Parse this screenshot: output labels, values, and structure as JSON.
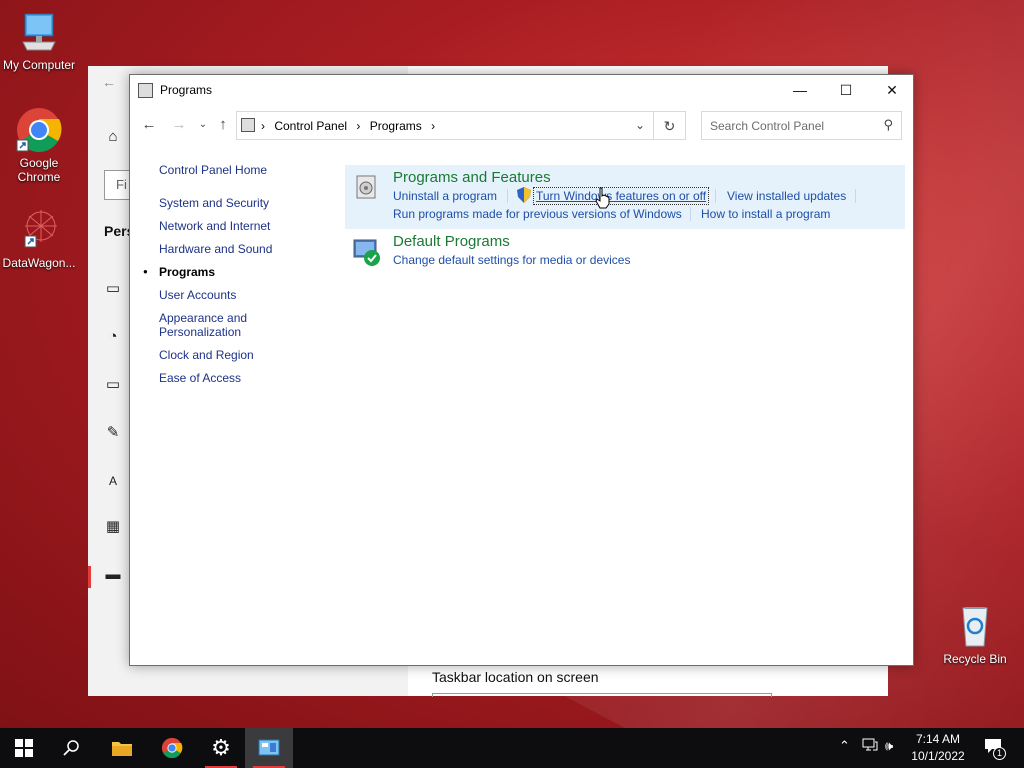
{
  "desktop": {
    "icons": [
      {
        "label": "My Computer",
        "icon": "computer-icon"
      },
      {
        "label": "Google Chrome",
        "icon": "chrome-icon"
      },
      {
        "label": "DataWagon...",
        "icon": "datawagon-icon"
      },
      {
        "label": "Recycle Bin",
        "icon": "recycle-bin-icon"
      }
    ]
  },
  "settings_window": {
    "search_partial": "Fi",
    "heading_partial": "Pers",
    "bottom_label": "Taskbar location on screen"
  },
  "window": {
    "title": "Programs",
    "buttons": {
      "minimize": "—",
      "maximize": "☐",
      "close": "✕"
    }
  },
  "address": {
    "crumbs": [
      "Control Panel",
      "Programs"
    ],
    "search_placeholder": "Search Control Panel"
  },
  "sidebar": {
    "home": "Control Panel Home",
    "items": [
      "System and Security",
      "Network and Internet",
      "Hardware and Sound",
      "Programs",
      "User Accounts",
      "Appearance and Personalization",
      "Clock and Region",
      "Ease of Access"
    ],
    "current": "Programs"
  },
  "categories": [
    {
      "title": "Programs and Features",
      "links": [
        "Uninstall a program",
        "Turn Windows features on or off",
        "View installed updates",
        "Run programs made for previous versions of Windows",
        "How to install a program"
      ]
    },
    {
      "title": "Default Programs",
      "links": [
        "Change default settings for media or devices"
      ]
    }
  ],
  "taskbar": {
    "time": "7:14 AM",
    "date": "10/1/2022",
    "notification_count": "1",
    "accent": "#e23b3b"
  }
}
